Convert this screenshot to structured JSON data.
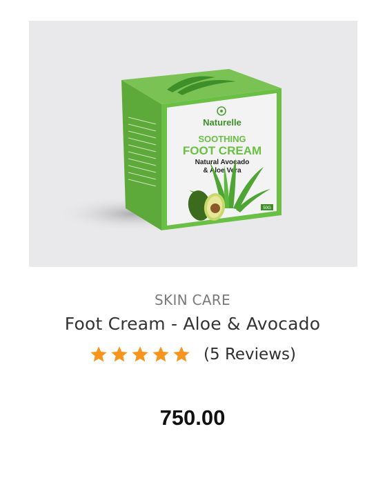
{
  "product": {
    "category": "SKIN CARE",
    "name": "Foot Cream - Aloe & Avocado",
    "rating": 5,
    "rating_max": 5,
    "reviews_label": "(5 Reviews)",
    "price": "750.00",
    "image_alt_icon": "product-box-icon"
  },
  "packaging": {
    "brand": "Naturelle",
    "line1": "SOOTHING",
    "line2": "FOOT CREAM",
    "line3": "Natural Avocado",
    "line4": "& Aloe Vera",
    "weight": "50G"
  },
  "colors": {
    "star": "#f7941d",
    "box_green": "#6abf45",
    "box_front": "#f2f2f2",
    "image_bg": "#e9e9eb"
  }
}
